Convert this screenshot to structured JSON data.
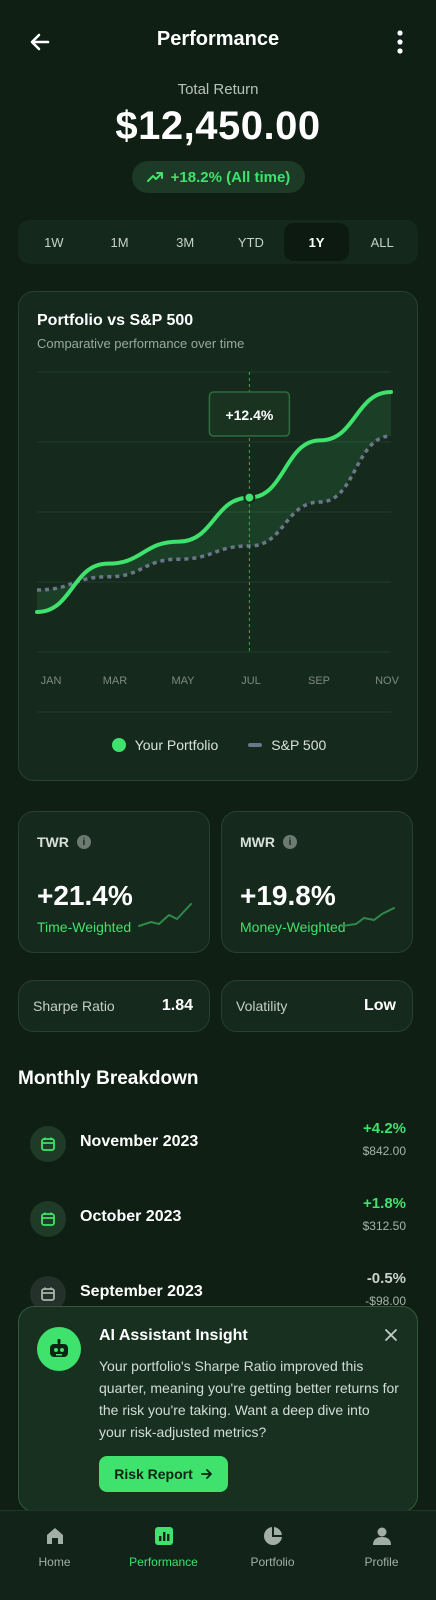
{
  "header": {
    "title": "Performance"
  },
  "summary": {
    "label": "Total Return",
    "value": "$12,450.00",
    "change": "+18.2% (All time)"
  },
  "timeframes": [
    {
      "label": "1W",
      "active": false
    },
    {
      "label": "1M",
      "active": false
    },
    {
      "label": "3M",
      "active": false
    },
    {
      "label": "YTD",
      "active": false
    },
    {
      "label": "1Y",
      "active": true
    },
    {
      "label": "ALL",
      "active": false
    }
  ],
  "chart": {
    "title": "Portfolio vs S&P 500",
    "subtitle": "Comparative performance over time",
    "tooltip": "+12.4%",
    "legend": {
      "portfolio": "Your Portfolio",
      "benchmark": "S&P 500"
    }
  },
  "chart_data": {
    "type": "line",
    "x": [
      "JAN",
      "MAR",
      "MAY",
      "JUL",
      "SEP",
      "NOV"
    ],
    "series": [
      {
        "name": "Your Portfolio",
        "color": "#3ee26c",
        "values": [
          0,
          0.22,
          0.32,
          0.52,
          0.78,
          1.0
        ]
      },
      {
        "name": "S&P 500",
        "color": "#6b7789",
        "values": [
          0.1,
          0.16,
          0.24,
          0.3,
          0.5,
          0.8
        ]
      }
    ],
    "annotation": {
      "x": "JUL",
      "label": "+12.4%"
    },
    "grid": true,
    "legend_position": "bottom"
  },
  "metrics": {
    "twr": {
      "label": "TWR",
      "value": "+21.4%",
      "sub": "Time-Weighted"
    },
    "mwr": {
      "label": "MWR",
      "value": "+19.8%",
      "sub": "Money-Weighted"
    },
    "sharpe": {
      "label": "Sharpe Ratio",
      "value": "1.84"
    },
    "volatility": {
      "label": "Volatility",
      "value": "Low"
    }
  },
  "monthly": {
    "title": "Monthly Breakdown",
    "items": [
      {
        "month": "November 2023",
        "pct": "+4.2%",
        "amount": "$842.00",
        "positive": true
      },
      {
        "month": "October 2023",
        "pct": "+1.8%",
        "amount": "$312.50",
        "positive": true
      },
      {
        "month": "September 2023",
        "pct": "-0.5%",
        "amount": "-$98.00",
        "positive": false
      }
    ]
  },
  "ai": {
    "title": "AI Assistant Insight",
    "text": "Your portfolio's Sharpe Ratio improved this quarter, meaning you're getting better returns for the risk you're taking. Want a deep dive into your risk-adjusted metrics?",
    "cta": "Risk Report"
  },
  "nav": [
    {
      "label": "Home",
      "active": false
    },
    {
      "label": "Performance",
      "active": true
    },
    {
      "label": "Portfolio",
      "active": false
    },
    {
      "label": "Profile",
      "active": false
    }
  ],
  "colors": {
    "accent": "#3ee26c",
    "negative": "#c9d2cc",
    "background": "#0f1f14"
  }
}
